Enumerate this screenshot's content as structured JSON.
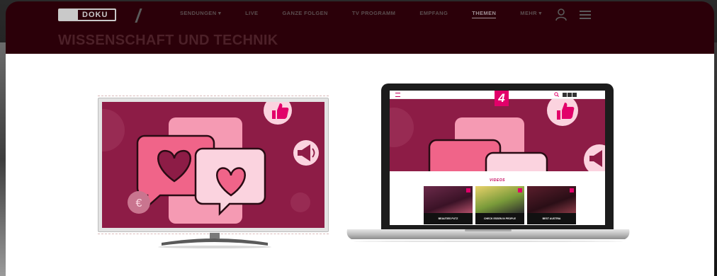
{
  "header": {
    "logo_text": "DOKU",
    "nav": [
      {
        "label": "SENDUNGEN ▾",
        "active": false
      },
      {
        "label": "LIVE",
        "active": false
      },
      {
        "label": "GANZE FOLGEN",
        "active": false
      },
      {
        "label": "TV PROGRAMM",
        "active": false
      },
      {
        "label": "EMPFANG",
        "active": false
      },
      {
        "label": "THEMEN",
        "active": true
      },
      {
        "label": "MEHR ▾",
        "active": false
      }
    ]
  },
  "page": {
    "section_title": "WISSENSCHAFT UND TECHNIK"
  },
  "illustration": {
    "tv_icons": [
      "heart-bubble-icon",
      "thumbs-up-icon",
      "megaphone-icon",
      "euro-icon"
    ],
    "laptop_site": {
      "logo": "4",
      "videos_heading": "VIDEOS",
      "thumbnails": [
        {
          "title": "BEAUTIES PUTZ"
        },
        {
          "title": "CHECK ESSEN IN PEOPLE"
        },
        {
          "title": "BEST AUSTRIA"
        }
      ]
    }
  },
  "colors": {
    "header_bg": "#2b0009",
    "magenta": "#e2006a",
    "hero_bg": "#8d1c46",
    "bubble_pink": "#f06489",
    "bubble_light": "#fbd3df"
  }
}
